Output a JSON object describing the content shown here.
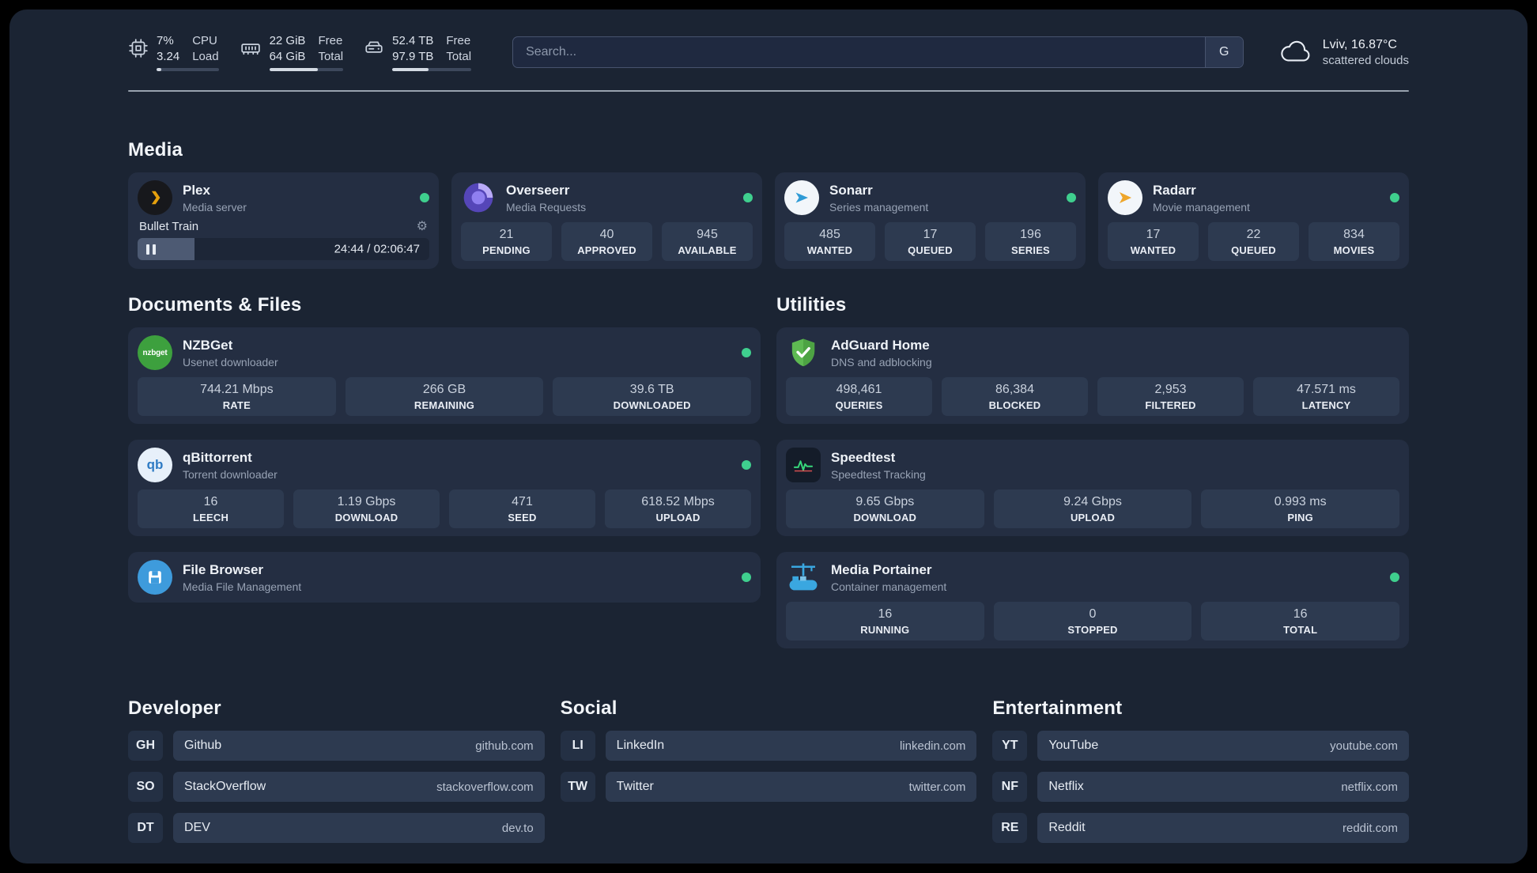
{
  "theme": {
    "panel_bg": "#1b2433",
    "card_bg": "#242e42",
    "tile_bg": "#2d3a50",
    "status_online": "#3fcf8e",
    "plex_gold": "#e5a00d"
  },
  "topbar": {
    "cpu": {
      "value": "7%",
      "load": "3.24",
      "label_top": "CPU",
      "label_bottom": "Load",
      "usage_percent": 7
    },
    "memory": {
      "free": "22 GiB",
      "total": "64 GiB",
      "label_top": "Free",
      "label_bottom": "Total",
      "usage_percent": 66
    },
    "disk": {
      "free": "52.4 TB",
      "total": "97.9 TB",
      "label_top": "Free",
      "label_bottom": "Total",
      "usage_percent": 46
    },
    "search": {
      "placeholder": "Search...",
      "button_label": "G"
    },
    "weather": {
      "location": "Lviv, 16.87°C",
      "condition": "scattered clouds"
    }
  },
  "media": {
    "title": "Media",
    "plex": {
      "name": "Plex",
      "subtitle": "Media server",
      "now_playing": {
        "title": "Bullet Train",
        "time": "24:44 / 02:06:47",
        "progress_percent": 19.6
      }
    },
    "overseerr": {
      "name": "Overseerr",
      "subtitle": "Media Requests",
      "stats": [
        {
          "value": "21",
          "label": "PENDING"
        },
        {
          "value": "40",
          "label": "APPROVED"
        },
        {
          "value": "945",
          "label": "AVAILABLE"
        }
      ]
    },
    "sonarr": {
      "name": "Sonarr",
      "subtitle": "Series management",
      "stats": [
        {
          "value": "485",
          "label": "WANTED"
        },
        {
          "value": "17",
          "label": "QUEUED"
        },
        {
          "value": "196",
          "label": "SERIES"
        }
      ]
    },
    "radarr": {
      "name": "Radarr",
      "subtitle": "Movie management",
      "stats": [
        {
          "value": "17",
          "label": "WANTED"
        },
        {
          "value": "22",
          "label": "QUEUED"
        },
        {
          "value": "834",
          "label": "MOVIES"
        }
      ]
    }
  },
  "documents": {
    "title": "Documents & Files",
    "nzbget": {
      "name": "NZBGet",
      "subtitle": "Usenet downloader",
      "stats": [
        {
          "value": "744.21 Mbps",
          "label": "RATE"
        },
        {
          "value": "266 GB",
          "label": "REMAINING"
        },
        {
          "value": "39.6 TB",
          "label": "DOWNLOADED"
        }
      ]
    },
    "qbittorrent": {
      "name": "qBittorrent",
      "subtitle": "Torrent downloader",
      "stats": [
        {
          "value": "16",
          "label": "LEECH"
        },
        {
          "value": "1.19 Gbps",
          "label": "DOWNLOAD"
        },
        {
          "value": "471",
          "label": "SEED"
        },
        {
          "value": "618.52 Mbps",
          "label": "UPLOAD"
        }
      ]
    },
    "filebrowser": {
      "name": "File Browser",
      "subtitle": "Media File Management"
    }
  },
  "utilities": {
    "title": "Utilities",
    "adguard": {
      "name": "AdGuard Home",
      "subtitle": "DNS and adblocking",
      "stats": [
        {
          "value": "498,461",
          "label": "QUERIES"
        },
        {
          "value": "86,384",
          "label": "BLOCKED"
        },
        {
          "value": "2,953",
          "label": "FILTERED"
        },
        {
          "value": "47.571 ms",
          "label": "LATENCY"
        }
      ]
    },
    "speedtest": {
      "name": "Speedtest",
      "subtitle": "Speedtest Tracking",
      "stats": [
        {
          "value": "9.65 Gbps",
          "label": "DOWNLOAD"
        },
        {
          "value": "9.24 Gbps",
          "label": "UPLOAD"
        },
        {
          "value": "0.993 ms",
          "label": "PING"
        }
      ]
    },
    "portainer": {
      "name": "Media Portainer",
      "subtitle": "Container management",
      "stats": [
        {
          "value": "16",
          "label": "RUNNING"
        },
        {
          "value": "0",
          "label": "STOPPED"
        },
        {
          "value": "16",
          "label": "TOTAL"
        }
      ]
    }
  },
  "links": {
    "developer": {
      "title": "Developer",
      "items": [
        {
          "abbr": "GH",
          "name": "Github",
          "domain": "github.com"
        },
        {
          "abbr": "SO",
          "name": "StackOverflow",
          "domain": "stackoverflow.com"
        },
        {
          "abbr": "DT",
          "name": "DEV",
          "domain": "dev.to"
        }
      ]
    },
    "social": {
      "title": "Social",
      "items": [
        {
          "abbr": "LI",
          "name": "LinkedIn",
          "domain": "linkedin.com"
        },
        {
          "abbr": "TW",
          "name": "Twitter",
          "domain": "twitter.com"
        }
      ]
    },
    "entertainment": {
      "title": "Entertainment",
      "items": [
        {
          "abbr": "YT",
          "name": "YouTube",
          "domain": "youtube.com"
        },
        {
          "abbr": "NF",
          "name": "Netflix",
          "domain": "netflix.com"
        },
        {
          "abbr": "RE",
          "name": "Reddit",
          "domain": "reddit.com"
        }
      ]
    }
  },
  "icons": {
    "gear": "⚙",
    "nzbget_text": "nzbget",
    "qbittorrent_text": "qb"
  }
}
